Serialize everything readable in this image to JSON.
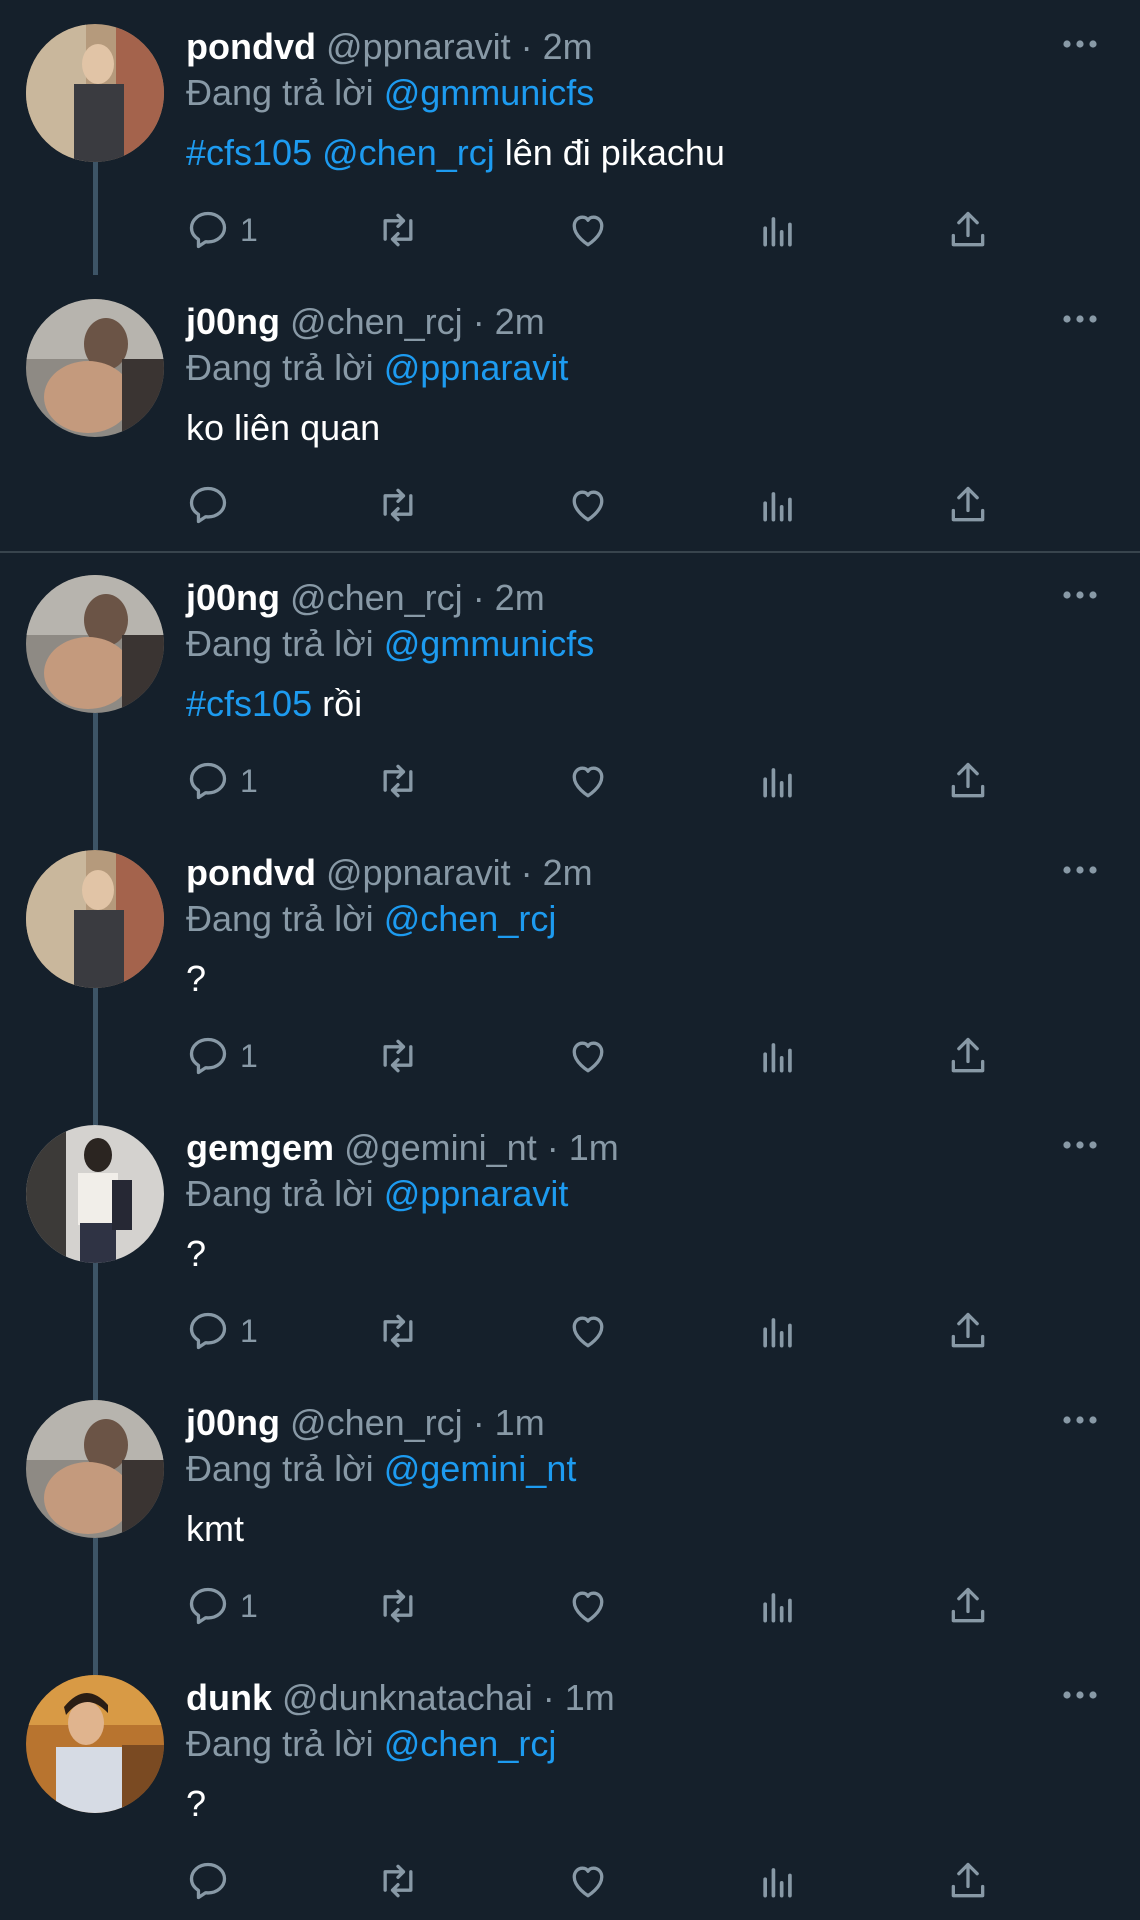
{
  "reply_prefix": "Đang trả lời",
  "tweets": [
    {
      "name": "pondvd",
      "handle": "@ppnaravit",
      "time": "· 2m",
      "reply_to": "@gmmunicfs",
      "body": [
        {
          "text": "#cfs105",
          "link": true
        },
        {
          "text": " ",
          "link": false
        },
        {
          "text": "@chen_rcj",
          "link": true
        },
        {
          "text": " lên đi pikachu",
          "link": false
        }
      ],
      "reply_count": "1"
    },
    {
      "name": "j00ng",
      "handle": "@chen_rcj",
      "time": "· 2m",
      "reply_to": "@ppnaravit",
      "body": [
        {
          "text": "ko liên quan",
          "link": false
        }
      ],
      "reply_count": ""
    },
    {
      "name": "j00ng",
      "handle": "@chen_rcj",
      "time": "· 2m",
      "reply_to": "@gmmunicfs",
      "body": [
        {
          "text": "#cfs105",
          "link": true
        },
        {
          "text": " rồi",
          "link": false
        }
      ],
      "reply_count": "1"
    },
    {
      "name": "pondvd",
      "handle": "@ppnaravit",
      "time": "· 2m",
      "reply_to": "@chen_rcj",
      "body": [
        {
          "text": "?",
          "link": false
        }
      ],
      "reply_count": "1"
    },
    {
      "name": "gemgem",
      "handle": "@gemini_nt",
      "time": "· 1m",
      "reply_to": "@ppnaravit",
      "body": [
        {
          "text": "?",
          "link": false
        }
      ],
      "reply_count": "1"
    },
    {
      "name": "j00ng",
      "handle": "@chen_rcj",
      "time": "· 1m",
      "reply_to": "@gemini_nt",
      "body": [
        {
          "text": "kmt",
          "link": false
        }
      ],
      "reply_count": "1"
    },
    {
      "name": "dunk",
      "handle": "@dunknatachai",
      "time": "· 1m",
      "reply_to": "@chen_rcj",
      "body": [
        {
          "text": "?",
          "link": false
        }
      ],
      "reply_count": ""
    }
  ],
  "colors": {
    "background": "#15202b",
    "link": "#1d9bf0",
    "muted": "#8899a6",
    "thread_line": "#3d5466"
  },
  "icons": [
    "reply-icon",
    "retweet-icon",
    "like-icon",
    "analytics-icon",
    "share-icon",
    "more-icon"
  ]
}
